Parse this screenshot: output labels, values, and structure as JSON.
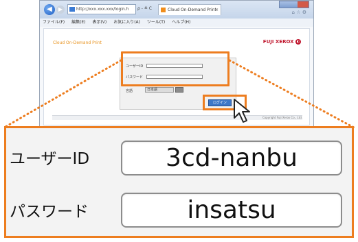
{
  "browser": {
    "address_text": "http://xxx.xxx.xxx/login.h",
    "address_controls": "ρ - ≜ C",
    "tab_title": "Cloud On-Demand Print",
    "tab_close": "×",
    "tool_icons": "⌂ ☆ ⚙",
    "menu": [
      "ファイル(F)",
      "編集(E)",
      "表示(V)",
      "お気に入り(A)",
      "ツール(T)",
      "ヘルプ(H)"
    ]
  },
  "page": {
    "brand_left": "Cloud On-Demand Print",
    "brand_logo": "FUJI XEROX",
    "login": {
      "user_label": "ユーザーID",
      "password_label": "パスワード",
      "language_label": "言語",
      "language_value": "日本語",
      "login_button": "ログイン"
    },
    "footer_text": "Copyright Fuji Xerox Co., Ltd."
  },
  "zoom": {
    "user_id_label": "ユーザーID",
    "user_id_value": "3cd-nanbu",
    "password_label": "パスワード",
    "password_value": "insatsu"
  },
  "colors": {
    "highlight": "#ed7d1f",
    "login_button": "#3d78c8",
    "logo": "#c0182f"
  }
}
